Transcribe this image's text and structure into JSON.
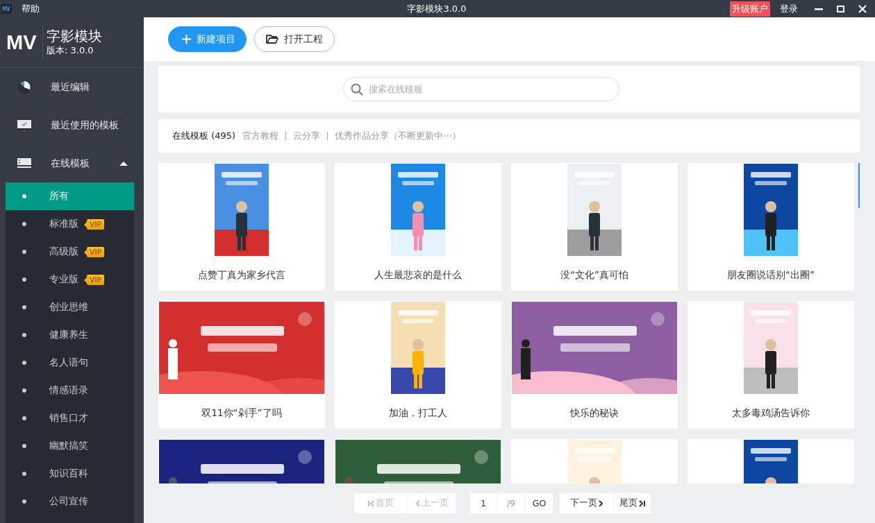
{
  "titlebar": {
    "logo": "MV",
    "menu": [
      "帮助"
    ],
    "title": "字影模块3.0.0",
    "upgrade": "升级账户",
    "login": "登录"
  },
  "sidebar": {
    "logo": "MV",
    "name": "字影模块",
    "version": "版本: 3.0.0",
    "nav": [
      {
        "label": "最近编辑"
      },
      {
        "label": "最近使用的模板"
      },
      {
        "label": "在线模板",
        "expanded": true,
        "children": [
          {
            "label": "所有",
            "selected": true
          },
          {
            "label": "标准版",
            "selected": false,
            "badge": "VIP"
          },
          {
            "label": "高级版",
            "selected": false,
            "badge": "VIP"
          },
          {
            "label": "专业版",
            "selected": false,
            "badge": "VIP"
          },
          {
            "label": "创业思维",
            "selected": false
          },
          {
            "label": "健康养生",
            "selected": false
          },
          {
            "label": "名人语句",
            "selected": false
          },
          {
            "label": "情感语录",
            "selected": false
          },
          {
            "label": "销售口才",
            "selected": false
          },
          {
            "label": "幽默搞笑",
            "selected": false
          },
          {
            "label": "知识百科",
            "selected": false
          },
          {
            "label": "公司宣传",
            "selected": false
          }
        ]
      }
    ]
  },
  "toolbar": [
    {
      "label": "新建项目",
      "kind": "primary"
    },
    {
      "label": "打开工程",
      "kind": "outline"
    }
  ],
  "search": {
    "placeholder": "搜索在线模板"
  },
  "tabs": [
    {
      "label": "在线模板 (495)",
      "selected": true
    },
    {
      "label": "官方教程",
      "selected": false
    },
    {
      "label": "云分享",
      "selected": false
    },
    {
      "label": "优秀作品分享（不断更新中⋯）",
      "selected": false
    }
  ],
  "templates": [
    {
      "title": "点赞丁真为家乡代言",
      "kind": "portrait"
    },
    {
      "title": "人生最悲哀的是什么",
      "kind": "portrait"
    },
    {
      "title": "没“文化”真可怕",
      "kind": "portrait"
    },
    {
      "title": "朋友圈说话别“出圈”",
      "kind": "portrait"
    },
    {
      "title": "双11你“剁手”了吗",
      "kind": "landscape"
    },
    {
      "title": "加油，打工人",
      "kind": "portrait"
    },
    {
      "title": "快乐的秘诀",
      "kind": "landscape"
    },
    {
      "title": "太多毒鸡汤告诉你",
      "kind": "portrait"
    },
    {
      "kind": "landscape"
    },
    {
      "kind": "landscape"
    },
    {
      "kind": "portrait"
    },
    {
      "kind": "portrait"
    }
  ],
  "pagination": {
    "buttons": [
      {
        "label": "首页",
        "kind": "first",
        "disabled": true
      },
      {
        "label": "上一页",
        "kind": "prev",
        "disabled": true
      },
      {
        "label": "下一页",
        "kind": "next",
        "disabled": false
      },
      {
        "label": "尾页",
        "kind": "last",
        "disabled": false
      }
    ],
    "page": "1",
    "total": "/9",
    "go": "GO"
  }
}
